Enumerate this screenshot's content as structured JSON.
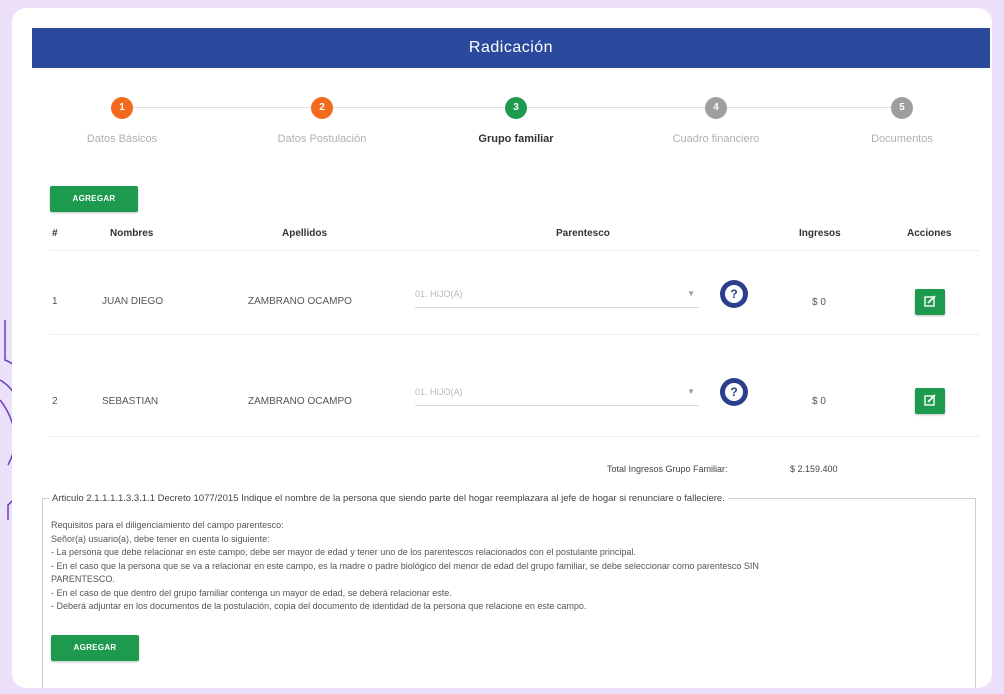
{
  "title": "Radicación",
  "steps": [
    {
      "number": "1",
      "label": "Datos Básicos",
      "color": "#f26b1d",
      "active": false
    },
    {
      "number": "2",
      "label": "Datos Postulación",
      "color": "#f26b1d",
      "active": false
    },
    {
      "number": "3",
      "label": "Grupo familiar",
      "color": "#1e9a4f",
      "active": true
    },
    {
      "number": "4",
      "label": "Cuadro financiero",
      "color": "#9e9e9e",
      "active": false
    },
    {
      "number": "5",
      "label": "Documentos",
      "color": "#9e9e9e",
      "active": false
    }
  ],
  "add_button_label": "AGREGAR",
  "table": {
    "headers": {
      "num": "#",
      "nombres": "Nombres",
      "apellidos": "Apellidos",
      "parentesco": "Parentesco",
      "ingresos": "Ingresos",
      "acciones": "Acciones"
    },
    "rows": [
      {
        "num": "1",
        "nombres": "JUAN DIEGO",
        "apellidos": "ZAMBRANO OCAMPO",
        "parentesco": "01. HIJO(A)",
        "ingresos": "$ 0"
      },
      {
        "num": "2",
        "nombres": "SEBASTIAN",
        "apellidos": "ZAMBRANO OCAMPO",
        "parentesco": "01. HIJO(A)",
        "ingresos": "$ 0"
      }
    ]
  },
  "total": {
    "label": "Total Ingresos Grupo Familiar:",
    "value": "$ 2.159.400"
  },
  "notes": {
    "title": "Articulo 2.1.1.1.1.3.3.1.1 Decreto 1077/2015 Indique el nombre de la persona que siendo parte del hogar reemplazara al jefe de hogar si renunciare o falleciere.",
    "lines": [
      "Requisitos para el diligenciamiento del campo parentesco:",
      "Señor(a) usuario(a), debe tener en cuenta lo siguiente:",
      "- La persona que debe relacionar en este campo, debe ser mayor de edad y tener uno de los parentescos relacionados con el postulante principal.",
      "- En el caso que la persona que se va a relacionar en este campo, es la madre o padre biológico del menor de edad del grupo familiar, se debe seleccionar como parentesco SIN",
      "PARENTESCO.",
      "- En el caso de que dentro del grupo familiar contenga un mayor de edad, se deberá relacionar este.",
      "- Deberá adjuntar en los documentos de la postulación, copia del documento de identidad de la persona que relacione en este campo."
    ]
  },
  "bottom_button_label": "AGREGAR",
  "colors": {
    "header": "#2b4a9e",
    "green": "#1e9a4f",
    "orange": "#f26b1d",
    "grey": "#9e9e9e",
    "background": "#ece0fa"
  }
}
